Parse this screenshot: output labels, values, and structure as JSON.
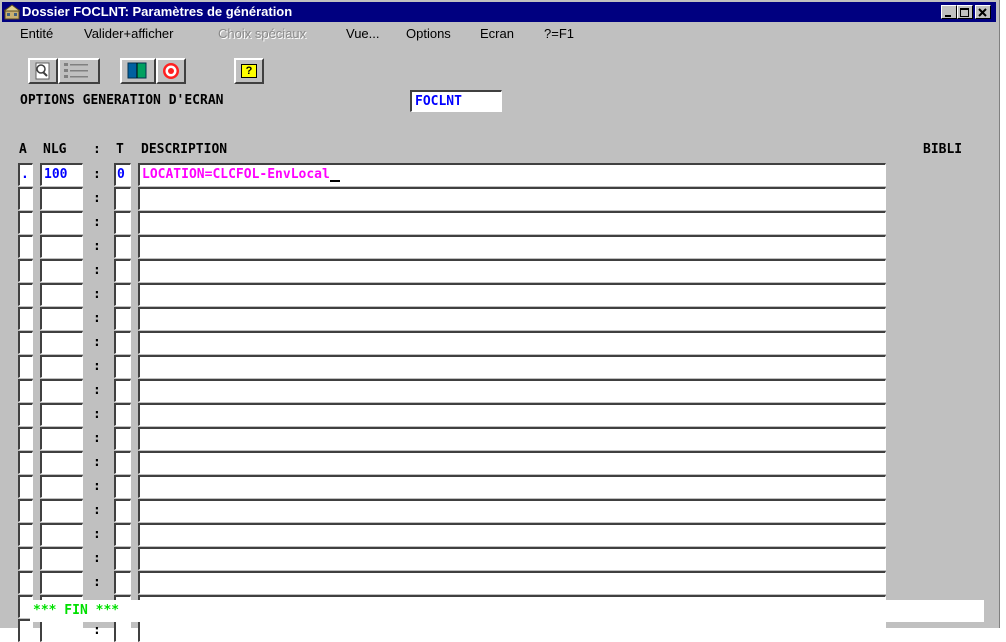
{
  "window": {
    "title": "Dossier FOCLNT: Paramètres de génération",
    "controls": [
      "minimize-icon",
      "maximize-icon",
      "close-icon"
    ]
  },
  "menu": {
    "entite": "Entité",
    "valider": "Valider+afficher",
    "choix": "Choix spéciaux",
    "vue": "Vue...",
    "options": "Options",
    "ecran": "Ecran",
    "aide": "?=F1"
  },
  "toolbar": {
    "icons": [
      "search-doc-icon",
      "list-icon",
      "book-icon",
      "target-icon",
      "help-icon"
    ],
    "help_label": "?"
  },
  "screen": {
    "heading": "OPTIONS GENERATION D'ECRAN",
    "dossier_value": "FOCLNT",
    "col_a": "A",
    "col_nlg": "NLG",
    "col_sep": ":",
    "col_t": "T",
    "col_description": "DESCRIPTION",
    "col_bibli": "BIBLI",
    "rows": [
      {
        "a": ".",
        "nlg": "100",
        "t": "0",
        "description": "LOCATION=CLCFOL-EnvLocal"
      },
      {
        "a": "",
        "nlg": "",
        "t": "",
        "description": ""
      },
      {
        "a": "",
        "nlg": "",
        "t": "",
        "description": ""
      },
      {
        "a": "",
        "nlg": "",
        "t": "",
        "description": ""
      },
      {
        "a": "",
        "nlg": "",
        "t": "",
        "description": ""
      },
      {
        "a": "",
        "nlg": "",
        "t": "",
        "description": ""
      },
      {
        "a": "",
        "nlg": "",
        "t": "",
        "description": ""
      },
      {
        "a": "",
        "nlg": "",
        "t": "",
        "description": ""
      },
      {
        "a": "",
        "nlg": "",
        "t": "",
        "description": ""
      },
      {
        "a": "",
        "nlg": "",
        "t": "",
        "description": ""
      },
      {
        "a": "",
        "nlg": "",
        "t": "",
        "description": ""
      },
      {
        "a": "",
        "nlg": "",
        "t": "",
        "description": ""
      },
      {
        "a": "",
        "nlg": "",
        "t": "",
        "description": ""
      },
      {
        "a": "",
        "nlg": "",
        "t": "",
        "description": ""
      },
      {
        "a": "",
        "nlg": "",
        "t": "",
        "description": ""
      },
      {
        "a": "",
        "nlg": "",
        "t": "",
        "description": ""
      },
      {
        "a": "",
        "nlg": "",
        "t": "",
        "description": ""
      },
      {
        "a": "",
        "nlg": "",
        "t": "",
        "description": ""
      },
      {
        "a": "",
        "nlg": "",
        "t": "",
        "description": ""
      },
      {
        "a": "",
        "nlg": "",
        "t": "",
        "description": ""
      }
    ],
    "status": "*** FIN ***"
  },
  "colors": {
    "title_bar": "#000080",
    "chrome": "#c0c0c0",
    "field_text_blue": "#0000ff",
    "description_magenta": "#ff00ff",
    "status_green": "#00e000"
  }
}
